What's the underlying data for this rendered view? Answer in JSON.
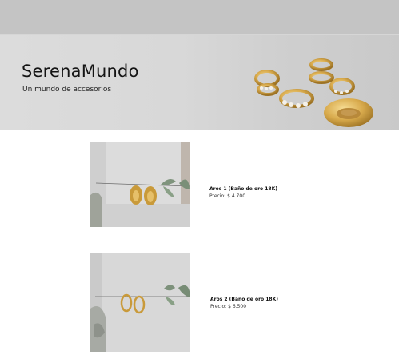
{
  "brand": {
    "name": "SerenaMundo",
    "tagline": "Un mundo de accesorios"
  },
  "hero": {
    "image_subject": "gold-jewelry-earcuffs-and-hoop"
  },
  "products": [
    {
      "name": "Aros 1 (Baño de oro 18K)",
      "price": "Precio: $ 4.700",
      "image_subject": "gold-hoop-earrings-on-branch"
    },
    {
      "name": "Aros 2 (Baño de oro 18K)",
      "price": "Precio: $ 6.500",
      "image_subject": "gold-hoop-earrings-on-branch"
    }
  ],
  "colors": {
    "topbar": "#c4c4c4",
    "hero_bg": "#d8d8d8",
    "gold": "#d4a84a"
  }
}
